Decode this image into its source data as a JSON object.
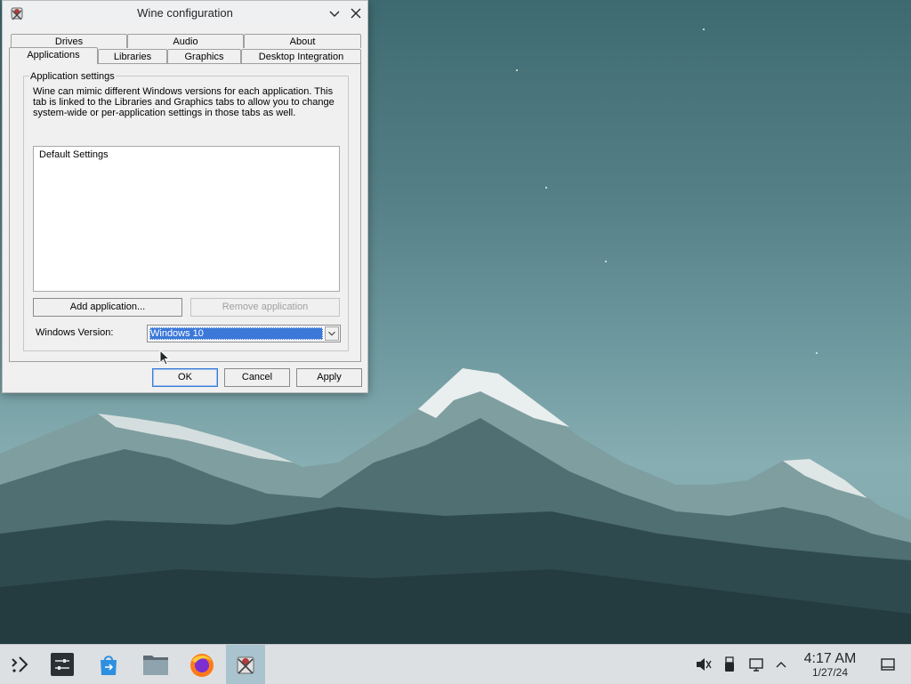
{
  "window": {
    "title": "Wine configuration",
    "tabs_row1": [
      "Drives",
      "Audio",
      "About"
    ],
    "tabs_row2": [
      "Applications",
      "Libraries",
      "Graphics",
      "Desktop Integration"
    ],
    "active_tab": "Applications",
    "group_title": "Application settings",
    "description": "Wine can mimic different Windows versions for each application. This tab is linked to the Libraries and Graphics tabs to allow you to change system-wide or per-application settings in those tabs as well.",
    "app_list": [
      "Default Settings"
    ],
    "add_button": "Add application...",
    "remove_button": "Remove application",
    "version_label": "Windows Version:",
    "version_value": "Windows 10",
    "ok": "OK",
    "cancel": "Cancel",
    "apply": "Apply"
  },
  "taskbar": {
    "apps": [
      "app-launcher-icon",
      "system-settings-icon",
      "discover-icon",
      "file-manager-icon",
      "firefox-icon",
      "wine-icon"
    ],
    "tray": [
      "volume-muted-icon",
      "usb-icon",
      "network-icon",
      "expand-tray-icon"
    ],
    "time": "4:17 AM",
    "date": "1/27/24"
  },
  "colors": {
    "selection": "#3b78d8",
    "active_task": "#a9c3cf",
    "sky": "#557f86"
  }
}
